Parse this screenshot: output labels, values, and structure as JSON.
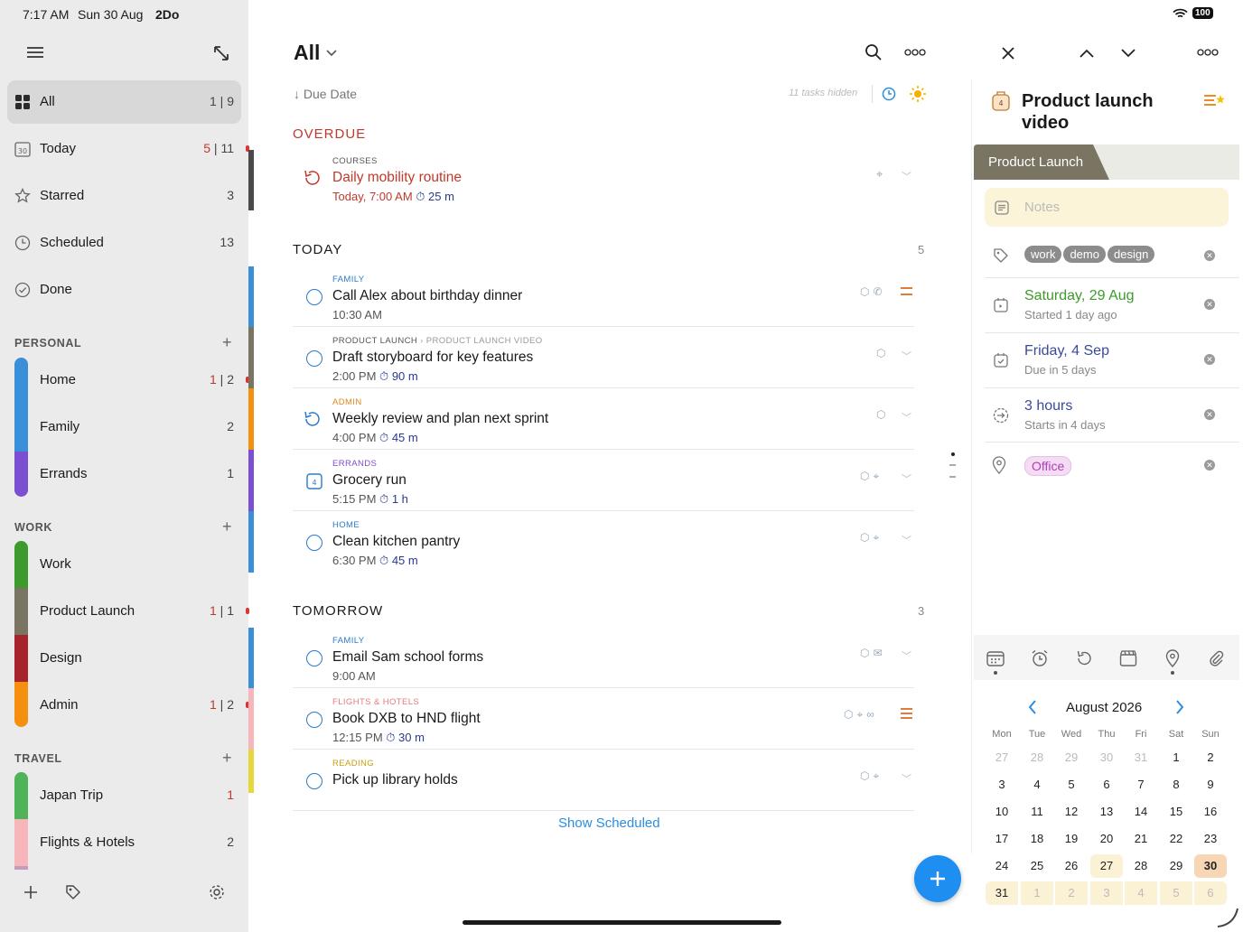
{
  "status": {
    "time": "7:17 AM",
    "date": "Sun 30 Aug",
    "app": "2Do",
    "battery": "100"
  },
  "sidebar": {
    "smart": [
      {
        "label": "All",
        "count": "1 | 9"
      },
      {
        "label": "Today",
        "count_red": "5",
        "count": " | 11"
      },
      {
        "label": "Starred",
        "count": "3"
      },
      {
        "label": "Scheduled",
        "count": "13"
      },
      {
        "label": "Done",
        "count": ""
      }
    ],
    "groups": [
      {
        "title": "PERSONAL",
        "items": [
          {
            "label": "Home",
            "count_red": "1",
            "count": " | 2",
            "color": "#3a8fd9"
          },
          {
            "label": "Family",
            "count": "2",
            "color": "#3a8fd9"
          },
          {
            "label": "Errands",
            "count": "1",
            "color": "#7b4fd1"
          }
        ]
      },
      {
        "title": "WORK",
        "items": [
          {
            "label": "Work",
            "count": "",
            "color": "#3d9a2c"
          },
          {
            "label": "Product Launch",
            "count_red": "1",
            "count": " | 1",
            "color": "#7a7462"
          },
          {
            "label": "Design",
            "count": "",
            "color": "#a8242d"
          },
          {
            "label": "Admin",
            "count_red": "1",
            "count": " | 2",
            "color": "#f5900f"
          }
        ]
      },
      {
        "title": "TRAVEL",
        "items": [
          {
            "label": "Japan Trip",
            "count_red": "1",
            "count": "",
            "color": "#4fb357"
          },
          {
            "label": "Flights & Hotels",
            "count": "2",
            "color": "#f7b6ba"
          }
        ]
      }
    ]
  },
  "list": {
    "title": "All",
    "sort": "Due Date",
    "hidden": "11 tasks hidden",
    "show_scheduled": "Show Scheduled",
    "sections": {
      "overdue": {
        "title": "OVERDUE",
        "count": ""
      },
      "today": {
        "title": "TODAY",
        "count": "5"
      },
      "tomorrow": {
        "title": "TOMORROW",
        "count": "3"
      }
    },
    "tasks": [
      {
        "cat": "COURSES",
        "title": "Daily mobility routine",
        "time": "Today, 7:00 AM",
        "dur": "25 m"
      },
      {
        "cat": "FAMILY",
        "title": "Call Alex about birthday dinner",
        "time": "10:30 AM",
        "dur": ""
      },
      {
        "cat": "PRODUCT LAUNCH",
        "cat2": "PRODUCT LAUNCH VIDEO",
        "title": "Draft storyboard for key features",
        "time": "2:00 PM",
        "dur": "90 m"
      },
      {
        "cat": "ADMIN",
        "title": "Weekly review and plan next sprint",
        "time": "4:00 PM",
        "dur": "45 m"
      },
      {
        "cat": "ERRANDS",
        "title": "Grocery run",
        "time": "5:15 PM",
        "dur": "1 h"
      },
      {
        "cat": "HOME",
        "title": "Clean kitchen pantry",
        "time": "6:30 PM",
        "dur": "45 m"
      },
      {
        "cat": "FAMILY",
        "title": "Email Sam school forms",
        "time": "9:00 AM",
        "dur": ""
      },
      {
        "cat": "FLIGHTS & HOTELS",
        "title": "Book DXB to HND flight",
        "time": "12:15 PM",
        "dur": "30 m"
      },
      {
        "cat": "READING",
        "title": "Pick up library holds",
        "time": "",
        "dur": ""
      }
    ]
  },
  "detail": {
    "title1": "Product launch",
    "title2": "video",
    "badge": "4",
    "project": "Product Launch",
    "notes_placeholder": "Notes",
    "tags": [
      "work",
      "demo",
      "design"
    ],
    "start": {
      "main": "Saturday, 29 Aug",
      "sub": "Started 1 day ago"
    },
    "due": {
      "main": "Friday, 4 Sep",
      "sub": "Due in 5 days"
    },
    "duration": {
      "main": "3 hours",
      "sub": "Starts in 4 days"
    },
    "location": "Office"
  },
  "calendar": {
    "month": "August 2026",
    "weekdays": [
      "Mon",
      "Tue",
      "Wed",
      "Thu",
      "Fri",
      "Sat",
      "Sun"
    ],
    "rows": [
      [
        "27",
        "28",
        "29",
        "30",
        "31",
        "1",
        "2"
      ],
      [
        "3",
        "4",
        "5",
        "6",
        "7",
        "8",
        "9"
      ],
      [
        "10",
        "11",
        "12",
        "13",
        "14",
        "15",
        "16"
      ],
      [
        "17",
        "18",
        "19",
        "20",
        "21",
        "22",
        "23"
      ],
      [
        "24",
        "25",
        "26",
        "27",
        "28",
        "29",
        "30"
      ],
      [
        "31",
        "1",
        "2",
        "3",
        "4",
        "5",
        "6"
      ]
    ]
  }
}
